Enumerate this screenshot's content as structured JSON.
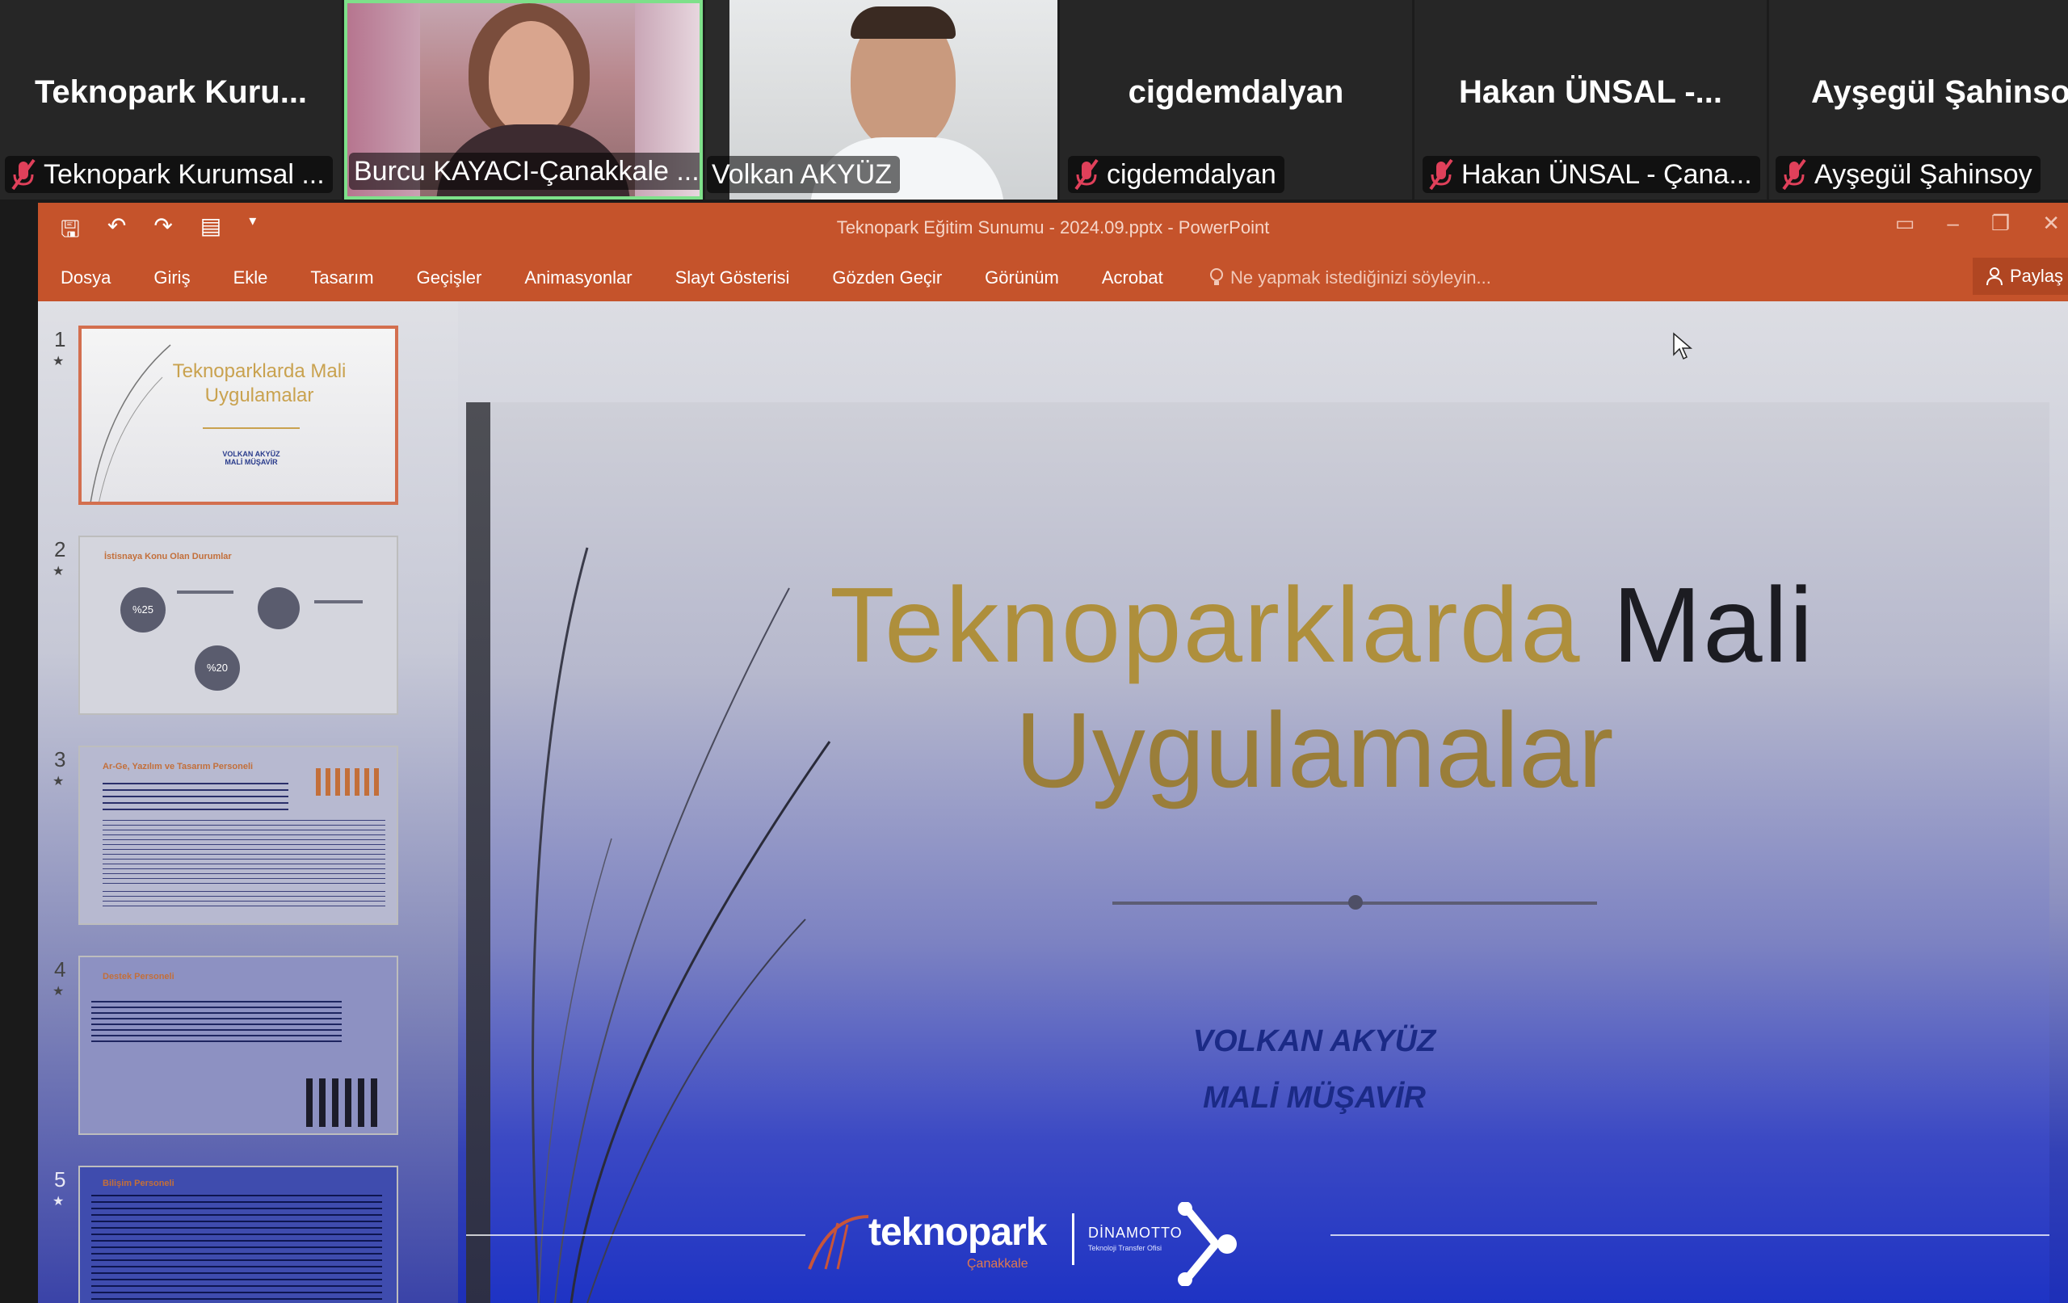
{
  "participants": [
    {
      "big_name": "Teknopark  Kuru...",
      "label": "Teknopark Kurumsal ...",
      "muted": true,
      "video": false
    },
    {
      "big_name": "",
      "label": "Burcu KAYACI-Çanakkale ...",
      "muted": false,
      "video": true,
      "active": true
    },
    {
      "big_name": "",
      "label": "Volkan AKYÜZ",
      "muted": false,
      "video": true
    },
    {
      "big_name": "cigdemdalyan",
      "label": "cigdemdalyan",
      "muted": true,
      "video": false
    },
    {
      "big_name": "Hakan ÜNSAL -...",
      "label": "Hakan ÜNSAL - Çana...",
      "muted": true,
      "video": false
    },
    {
      "big_name": "Ayşegül Şahinso",
      "label": "Ayşegül Şahinsoy",
      "muted": true,
      "video": false
    }
  ],
  "window": {
    "title": "Teknopark Eğitim Sunumu - 2024.09.pptx - PowerPoint",
    "tabs": [
      "Dosya",
      "Giriş",
      "Ekle",
      "Tasarım",
      "Geçişler",
      "Animasyonlar",
      "Slayt Gösterisi",
      "Gözden Geçir",
      "Görünüm",
      "Acrobat"
    ],
    "tell_me": "Ne yapmak istediğinizi söyleyin...",
    "share": "Paylaş"
  },
  "thumbnails": [
    {
      "num": "1",
      "title": "Teknoparklarda Mali Uygulamalar",
      "subtitle": "VOLKAN AKYÜZ\nMALİ MÜŞAVİR",
      "selected": true
    },
    {
      "num": "2",
      "title": "İstisnaya Konu Olan Durumlar",
      "badges": [
        "%25",
        "%20"
      ]
    },
    {
      "num": "3",
      "title": "Ar-Ge, Yazılım ve Tasarım Personeli"
    },
    {
      "num": "4",
      "title": "Destek Personeli"
    },
    {
      "num": "5",
      "title": "Bilişim Personeli"
    }
  ],
  "slide": {
    "title_gold": "Teknoparklarda",
    "title_dark": "Mali",
    "title_line2": "Uygulamalar",
    "author_name": "VOLKAN AKYÜZ",
    "author_title": "MALİ MÜŞAVİR",
    "logo_main": "teknopark",
    "logo_sub": "Çanakkale",
    "logo2_main": "DİNAMOTTO",
    "logo2_sub": "Teknoloji Transfer Ofisi"
  }
}
